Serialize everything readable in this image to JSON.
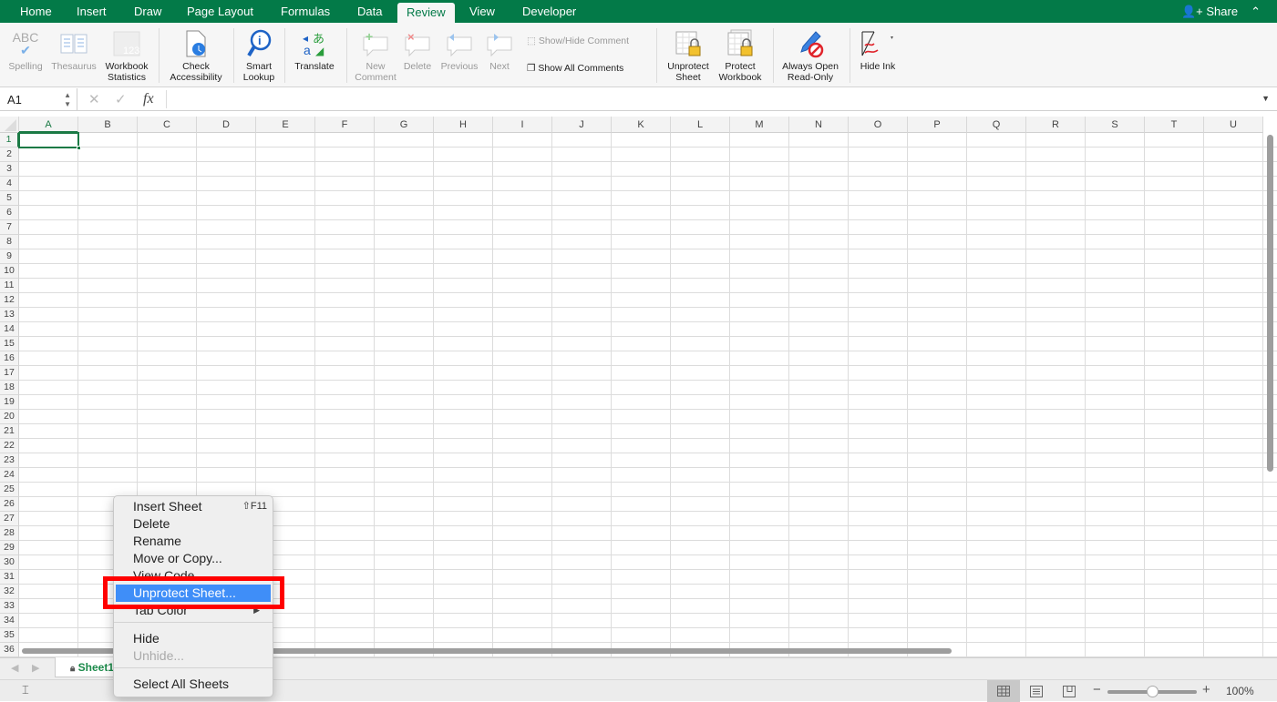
{
  "ribbon_tabs": [
    "Home",
    "Insert",
    "Draw",
    "Page Layout",
    "Formulas",
    "Data",
    "Review",
    "View",
    "Developer"
  ],
  "active_tab": "Review",
  "share_label": "Share",
  "ribbon": {
    "spelling": "Spelling",
    "thesaurus": "Thesaurus",
    "workbook_statistics": [
      "Workbook",
      "Statistics"
    ],
    "check_accessibility": [
      "Check",
      "Accessibility"
    ],
    "smart_lookup": [
      "Smart",
      "Lookup"
    ],
    "translate": "Translate",
    "new_comment": [
      "New",
      "Comment"
    ],
    "delete": "Delete",
    "previous": "Previous",
    "next": "Next",
    "show_hide_comment": "Show/Hide Comment",
    "show_all_comments": "Show All Comments",
    "unprotect_sheet": [
      "Unprotect",
      "Sheet"
    ],
    "protect_workbook": [
      "Protect",
      "Workbook"
    ],
    "always_open_read_only": [
      "Always Open",
      "Read-Only"
    ],
    "hide_ink": "Hide Ink"
  },
  "formula_bar": {
    "name_box": "A1",
    "fx": "fx",
    "value": ""
  },
  "columns": [
    "A",
    "B",
    "C",
    "D",
    "E",
    "F",
    "G",
    "H",
    "I",
    "J",
    "K",
    "L",
    "M",
    "N",
    "O",
    "P",
    "Q",
    "R",
    "S",
    "T",
    "U"
  ],
  "rows": 36,
  "selected_cell": "A1",
  "context_menu": {
    "items": [
      {
        "label": "Insert Sheet",
        "shortcut": "⇧F11"
      },
      {
        "label": "Delete"
      },
      {
        "label": "Rename"
      },
      {
        "label": "Move or Copy..."
      },
      {
        "label": "View Code"
      },
      {
        "label": "Unprotect Sheet...",
        "highlighted": true
      },
      {
        "label": "Tab Color",
        "submenu": true
      },
      {
        "label": "Hide"
      },
      {
        "label": "Unhide...",
        "disabled": true
      },
      {
        "label": "Select All Sheets"
      }
    ]
  },
  "sheet_tab": "Sheet1",
  "zoom_level": "100%",
  "zoom_fraction": 0.5
}
